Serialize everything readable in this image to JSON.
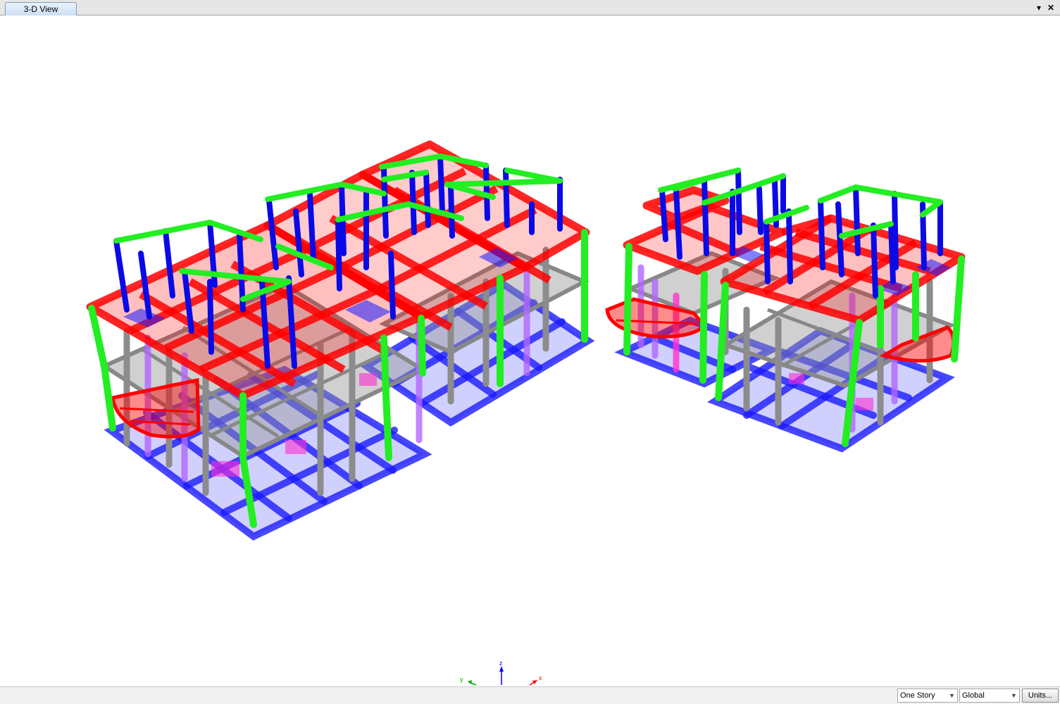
{
  "window": {
    "tab_title": "3-D View",
    "dropdown_glyph": "▾",
    "close_glyph": "✕"
  },
  "axes": {
    "x": "x",
    "y": "y",
    "z": "z"
  },
  "statusbar": {
    "story_filter": "One Story",
    "coordinate_system": "Global",
    "units_label": "Units..."
  },
  "colors": {
    "beam_top": "#ff0000",
    "column_top": "#0000ff",
    "roof_edge": "#00ff00",
    "foundation": "#0000ff",
    "column_mid": "#999999",
    "brace": "#a64dff",
    "wall_pink": "#ff33cc"
  }
}
